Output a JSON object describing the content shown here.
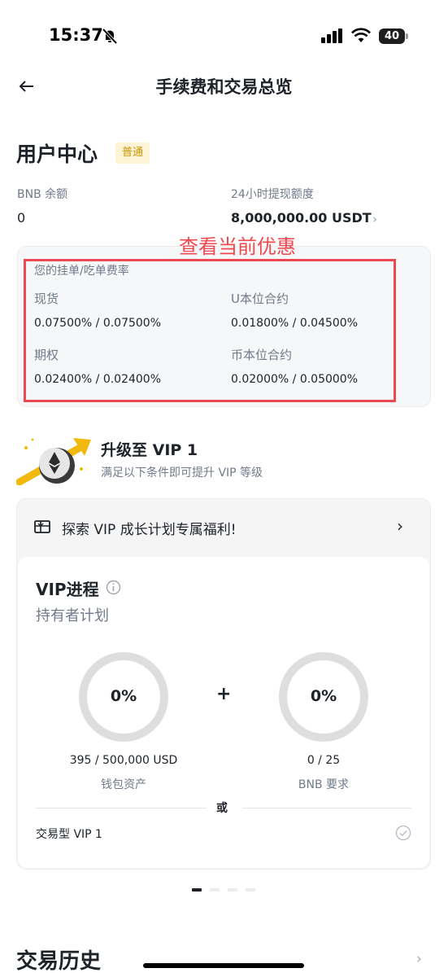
{
  "status_bar": {
    "time": "15:37",
    "battery": "40"
  },
  "header": {
    "title": "手续费和交易总览"
  },
  "user_center": {
    "title": "用户中心",
    "tier": "普通",
    "bnb_balance_label": "BNB 余额",
    "bnb_balance_value": "0",
    "withdraw_limit_label": "24小时提现额度",
    "withdraw_limit_value": "8,000,000.00 USDT"
  },
  "annotation": "查看当前优惠",
  "fees": {
    "title": "您的挂单/吃单费率",
    "items": [
      {
        "name": "现货",
        "value": "0.07500% / 0.07500%"
      },
      {
        "name": "U本位合约",
        "value": "0.01800% / 0.04500%"
      },
      {
        "name": "期权",
        "value": "0.02400% / 0.02400%"
      },
      {
        "name": "币本位合约",
        "value": "0.02000% / 0.05000%"
      }
    ]
  },
  "upgrade": {
    "title": "升级至 VIP 1",
    "subtitle": "满足以下条件即可提升 VIP 等级"
  },
  "vip": {
    "explore_label": "探索 VIP 成长计划专属福利!",
    "progress_title": "VIP进程",
    "plan": "持有者计划",
    "requirements": [
      {
        "percent": "0%",
        "progress": 0,
        "amount": "395 / 500,000 USD",
        "label": "钱包资产"
      },
      {
        "percent": "0%",
        "progress": 0,
        "amount": "0 / 25",
        "label": "BNB 要求"
      }
    ],
    "plus": "+",
    "or": "或",
    "trading_vip": "交易型 VIP 1"
  },
  "pager": {
    "count": 4,
    "active": 0
  },
  "history": {
    "title": "交易历史"
  },
  "colors": {
    "accent_yellow": "#f0b90b",
    "annotation_red": "#ec4a52",
    "muted_text": "#707a8a",
    "ring_track": "#dedede"
  },
  "icons": [
    "bell-slash-icon",
    "signal-icon",
    "wifi-icon",
    "battery-icon",
    "back-arrow-icon",
    "chevron-right-icon",
    "vip-upgrade-icon",
    "gift-card-icon",
    "info-icon",
    "check-circle-icon"
  ]
}
